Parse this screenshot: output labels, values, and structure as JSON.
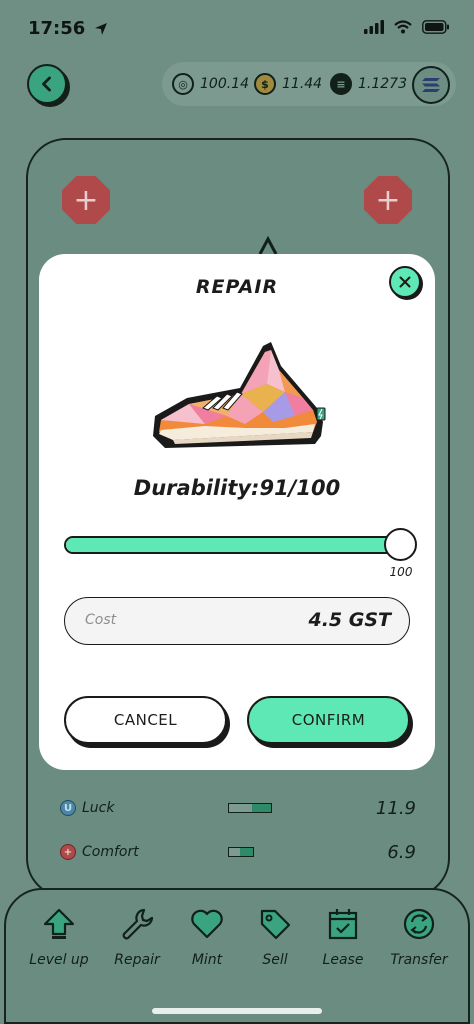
{
  "status_bar": {
    "time": "17:56"
  },
  "balances": [
    {
      "icon": "gmt-coin-icon",
      "value": "100.14"
    },
    {
      "icon": "gst-coin-icon",
      "value": "11.44"
    },
    {
      "icon": "sol-coin-icon",
      "value": "1.1273"
    }
  ],
  "stats": [
    {
      "icon_letter": "U",
      "label": "Luck",
      "value": "11.9",
      "fill": 0.45
    },
    {
      "icon_letter": "+",
      "label": "Comfort",
      "value": "6.9",
      "fill": 0.55
    }
  ],
  "bottom_nav": [
    {
      "label": "Level up",
      "icon": "level-up-icon"
    },
    {
      "label": "Repair",
      "icon": "wrench-icon"
    },
    {
      "label": "Mint",
      "icon": "heart-icon"
    },
    {
      "label": "Sell",
      "icon": "tag-icon"
    },
    {
      "label": "Lease",
      "icon": "calendar-icon"
    },
    {
      "label": "Transfer",
      "icon": "transfer-icon"
    }
  ],
  "modal": {
    "title": "REPAIR",
    "durability_text": "Durability:91/100",
    "slider_value": 100,
    "slider_max_label": "100",
    "slider_fill": 0.95,
    "cost_label": "Cost",
    "cost_value": "4.5 GST",
    "cancel_label": "CANCEL",
    "confirm_label": "CONFIRM"
  },
  "colors": {
    "accent": "#5ee8b6",
    "overlay": "#6f8f84",
    "danger": "#b04a4a"
  }
}
